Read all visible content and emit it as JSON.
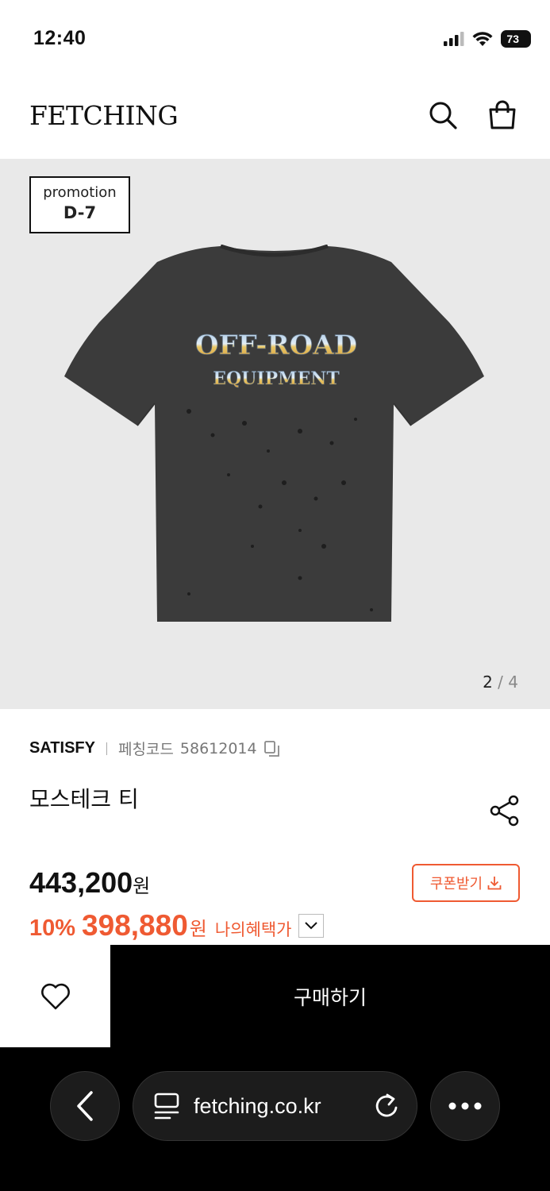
{
  "status_bar": {
    "time": "12:40",
    "battery": "73"
  },
  "header": {
    "logo": "FETCHING"
  },
  "gallery": {
    "promo_label": "promotion",
    "promo_day": "D-7",
    "print_line1": "OFF-ROAD",
    "print_line2": "EQUIPMENT",
    "current": "2",
    "separator": "/",
    "total": "4"
  },
  "product": {
    "brand": "SATISFY",
    "code_label": "페칭코드",
    "code_value": "58612014",
    "name": "모스테크 티",
    "original_price": "443,200",
    "currency": "원",
    "coupon_label": "쿠폰받기",
    "discount": "10%",
    "sale_price": "398,880",
    "benefit_label": "나의혜택가"
  },
  "purchase": {
    "buy_label": "구매하기"
  },
  "browser": {
    "url": "fetching.co.kr"
  },
  "colors": {
    "accent": "#ef5a32",
    "gallery_bg": "#e9e9e9",
    "shirt": "#3b3b3b"
  }
}
